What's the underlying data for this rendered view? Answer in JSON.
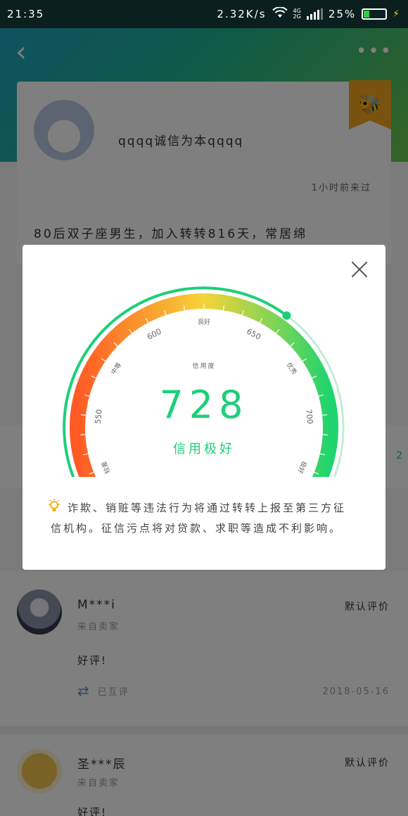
{
  "status_bar": {
    "time": "21:35",
    "network_speed": "2.32K/s",
    "net_type_top": "4G",
    "net_type_bottom": "2G",
    "battery": "25%",
    "battery_level": 0.25
  },
  "header": {
    "back_icon": "back-chevron-icon",
    "more_icon": "more-dots-icon"
  },
  "profile": {
    "username": "qqqq诚信为本qqqq",
    "last_seen": "1小时前来过",
    "bio": "80后双子座男生，加入转转816天，常居绵"
  },
  "section": {
    "count": "2"
  },
  "reviews": [
    {
      "name": "M***i",
      "from": "来自卖家",
      "text": "好评!",
      "type": "默认评价",
      "mutual": "已互评",
      "date": "2018-05-16"
    },
    {
      "name": "圣***辰",
      "from": "来自卖家",
      "text": "好评!",
      "type": "默认评价"
    }
  ],
  "credit": {
    "label": "信用度",
    "score": "728",
    "rating": "信用极好",
    "tip": "诈欺、销赃等违法行为将通过转转上报至第三方征信机构。征信污点将对贷款、求职等造成不利影响。",
    "min": 350,
    "max": 950,
    "value": 728,
    "ticks": [
      "350",
      "550",
      "600",
      "650",
      "700",
      "950"
    ],
    "levels": [
      "较差",
      "中等",
      "良好",
      "优秀",
      "极好"
    ],
    "colors": {
      "accent": "#1ecf7a",
      "low": "#ff5a24",
      "mid": "#f6d439",
      "high": "#1fd46e"
    }
  }
}
